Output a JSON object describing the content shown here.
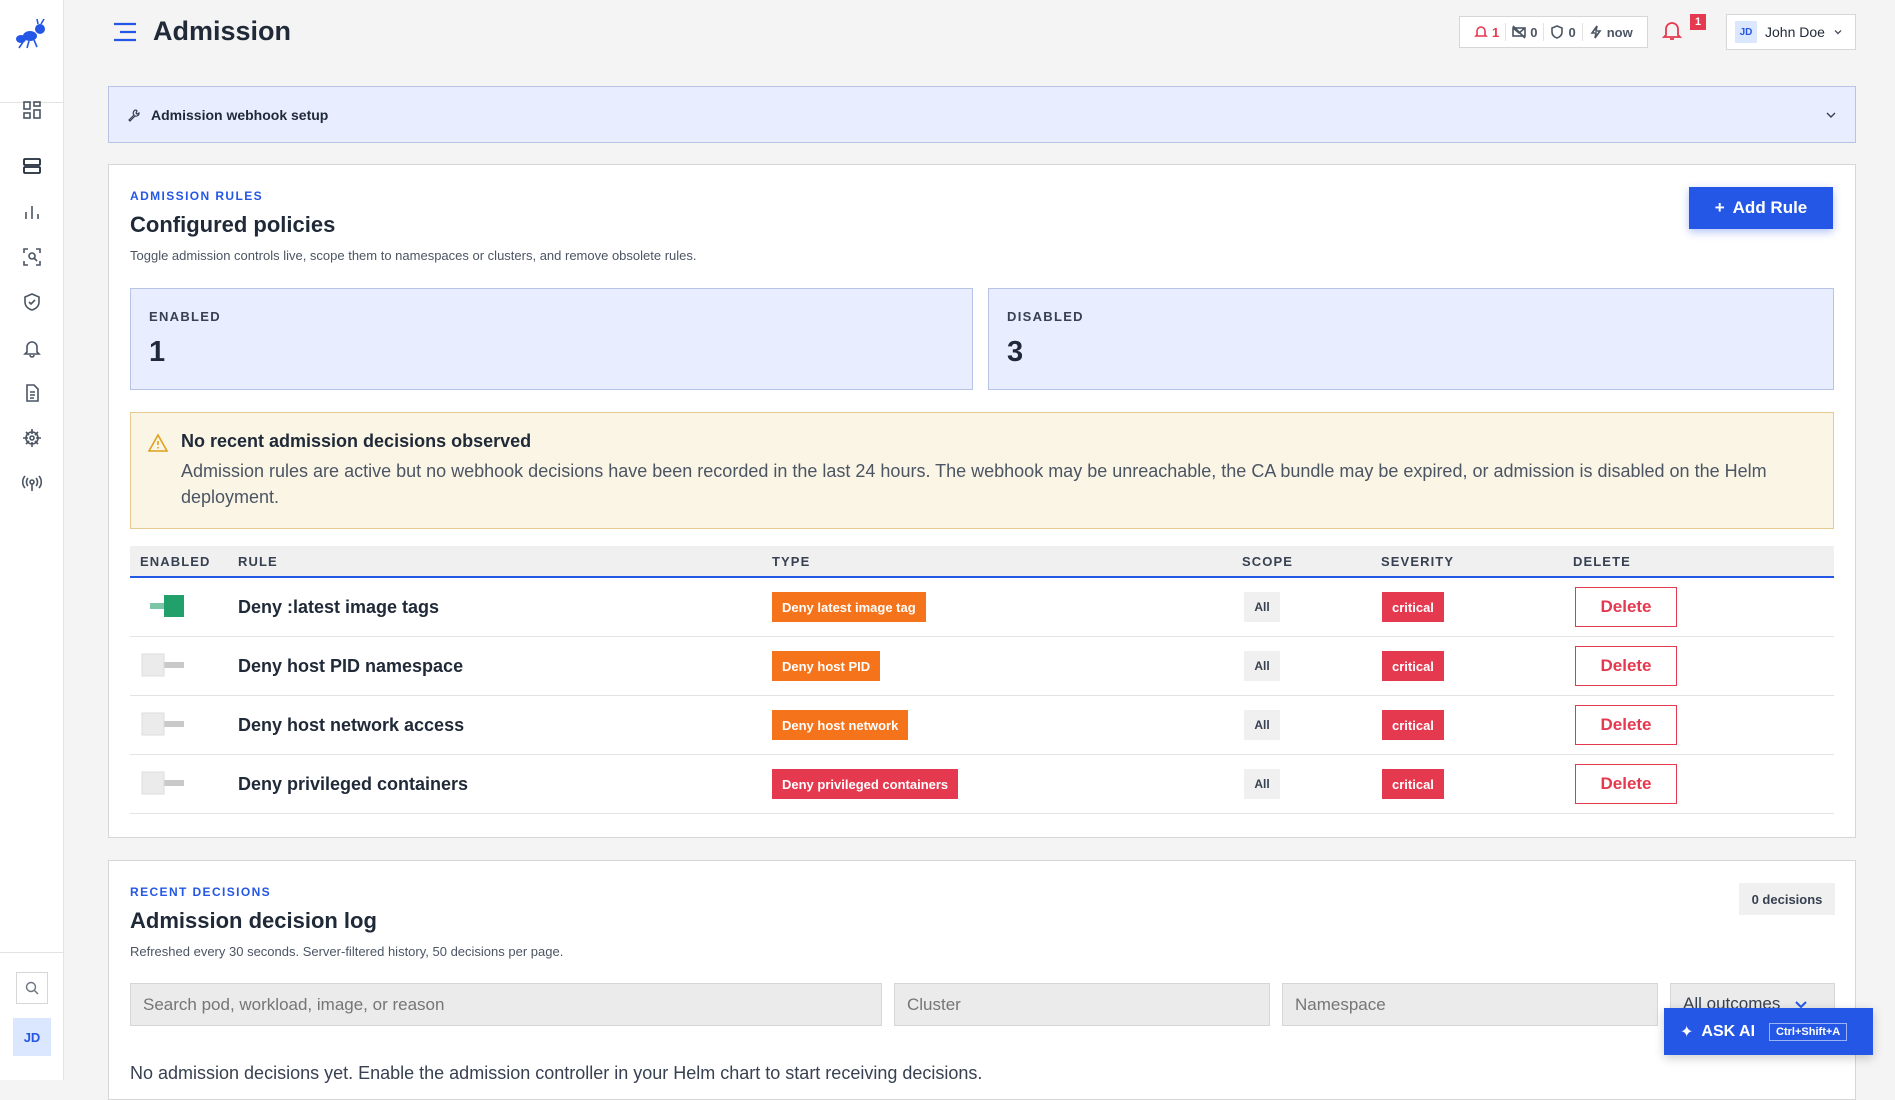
{
  "page": {
    "title": "Admission"
  },
  "status": {
    "alerts": "1",
    "messages": "0",
    "shield": "0",
    "updated": "now",
    "notifications": "1"
  },
  "user": {
    "initials": "JD",
    "name": "John Doe"
  },
  "sidebar": {
    "items": [
      {
        "name": "dashboard-icon"
      },
      {
        "name": "servers-icon"
      },
      {
        "name": "chart-icon"
      },
      {
        "name": "scan-icon"
      },
      {
        "name": "shield-icon"
      },
      {
        "name": "bell-icon"
      },
      {
        "name": "document-icon"
      },
      {
        "name": "helm-icon"
      },
      {
        "name": "broadcast-icon"
      }
    ],
    "avatar": "JD"
  },
  "webhook": {
    "label": "Admission webhook setup"
  },
  "rules": {
    "eyebrow": "ADMISSION RULES",
    "title": "Configured policies",
    "subtitle": "Toggle admission controls live, scope them to namespaces or clusters, and remove obsolete rules.",
    "add_label": "Add Rule",
    "enabled_label": "ENABLED",
    "enabled_count": "1",
    "disabled_label": "DISABLED",
    "disabled_count": "3",
    "warning_title": "No recent admission decisions observed",
    "warning_text": "Admission rules are active but no webhook decisions have been recorded in the last 24 hours. The webhook may be unreachable, the CA bundle may be expired, or admission is disabled on the Helm deployment.",
    "columns": [
      "ENABLED",
      "RULE",
      "TYPE",
      "SCOPE",
      "SEVERITY",
      "DELETE"
    ],
    "rows": [
      {
        "enabled": true,
        "name": "Deny :latest image tags",
        "type": "Deny latest image tag",
        "type_color": "#f5741b",
        "scope": "All",
        "severity": "critical",
        "delete": "Delete"
      },
      {
        "enabled": false,
        "name": "Deny host PID namespace",
        "type": "Deny host PID",
        "type_color": "#f5741b",
        "scope": "All",
        "severity": "critical",
        "delete": "Delete"
      },
      {
        "enabled": false,
        "name": "Deny host network access",
        "type": "Deny host network",
        "type_color": "#f5741b",
        "scope": "All",
        "severity": "critical",
        "delete": "Delete"
      },
      {
        "enabled": false,
        "name": "Deny privileged containers",
        "type": "Deny privileged containers",
        "type_color": "#e53950",
        "scope": "All",
        "severity": "critical",
        "delete": "Delete"
      }
    ]
  },
  "log": {
    "eyebrow": "RECENT DECISIONS",
    "title": "Admission decision log",
    "subtitle": "Refreshed every 30 seconds. Server-filtered history, 50 decisions per page.",
    "count": "0 decisions",
    "search_placeholder": "Search pod, workload, image, or reason",
    "cluster_placeholder": "Cluster",
    "namespace_placeholder": "Namespace",
    "outcome": "All outcomes",
    "empty": "No admission decisions yet. Enable the admission controller in your Helm chart to start receiving decisions."
  },
  "ask_ai": {
    "label": "ASK AI",
    "shortcut": "Ctrl+Shift+A"
  },
  "colors": {
    "accent": "#2457e6",
    "danger": "#e53950",
    "orange": "#f5741b",
    "toggle_on": "#22a06b"
  }
}
